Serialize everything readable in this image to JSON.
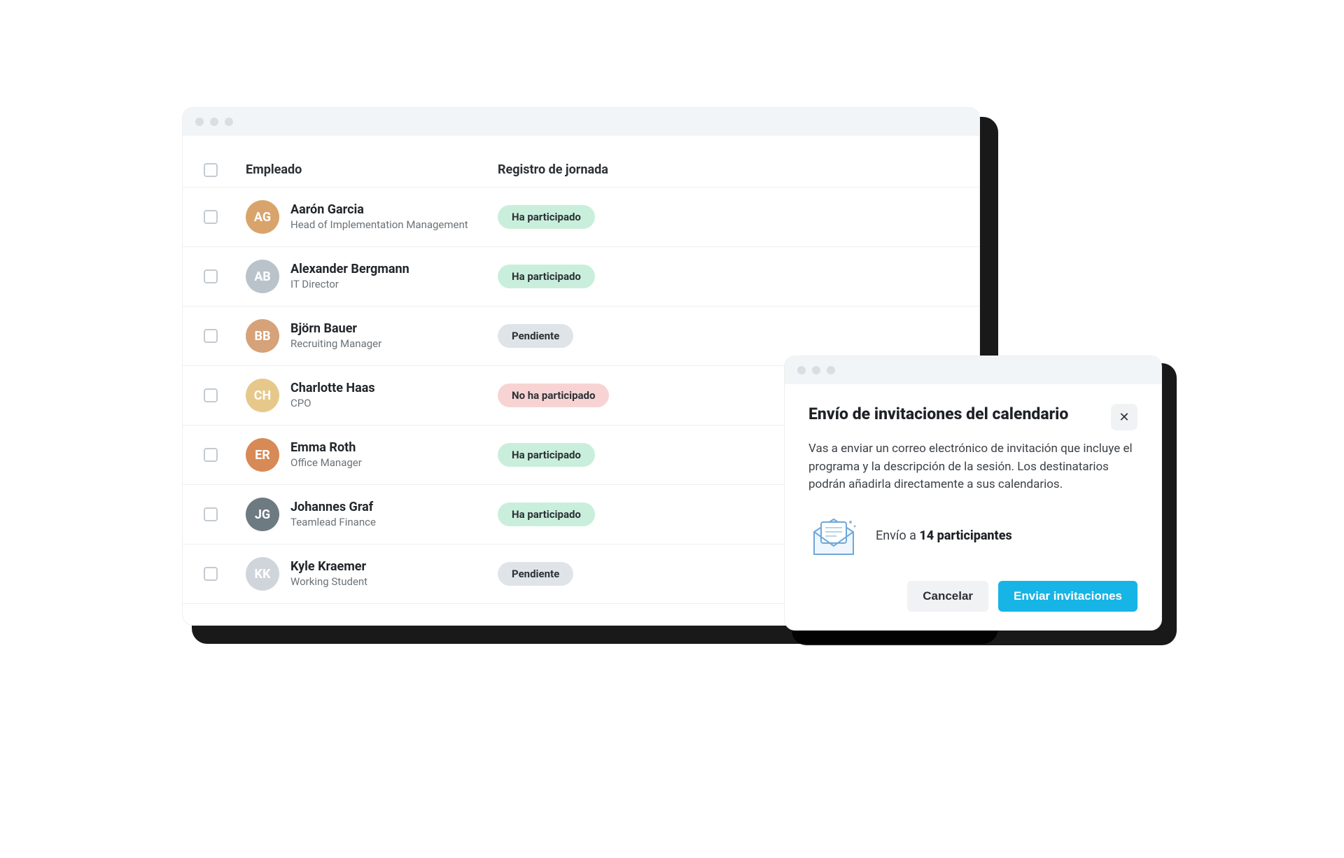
{
  "table": {
    "headers": {
      "employee": "Empleado",
      "status": "Registro de jornada"
    },
    "status_labels": {
      "participated": "Ha participado",
      "pending": "Pendiente",
      "not_participated": "No ha participado"
    },
    "rows": [
      {
        "name": "Aarón Garcia",
        "role": "Head of Implementation Management",
        "status": "participated",
        "avatar_bg": "#d9a46b",
        "initials": "AG"
      },
      {
        "name": "Alexander Bergmann",
        "role": "IT Director",
        "status": "participated",
        "avatar_bg": "#b9c3c9",
        "initials": "AB"
      },
      {
        "name": "Björn Bauer",
        "role": "Recruiting Manager",
        "status": "pending",
        "avatar_bg": "#d6a27a",
        "initials": "BB"
      },
      {
        "name": "Charlotte Haas",
        "role": "CPO",
        "status": "not_participated",
        "avatar_bg": "#e6c98a",
        "initials": "CH"
      },
      {
        "name": "Emma Roth",
        "role": "Office Manager",
        "status": "participated",
        "avatar_bg": "#d78a56",
        "initials": "ER"
      },
      {
        "name": "Johannes Graf",
        "role": "Teamlead Finance",
        "status": "participated",
        "avatar_bg": "#6e7a82",
        "initials": "JG"
      },
      {
        "name": "Kyle Kraemer",
        "role": "Working Student",
        "status": "pending",
        "avatar_bg": "#cfd5da",
        "initials": "KK"
      }
    ]
  },
  "modal": {
    "title": "Envío de invitaciones del calendario",
    "description": "Vas a enviar un correo electrónico de invitación que incluye el programa y la descripción de la sesión. Los destinatarios podrán añadirla directamente a sus calendarios.",
    "send_prefix": "Envío a ",
    "send_bold": "14 participantes",
    "cancel": "Cancelar",
    "confirm": "Enviar invitaciones",
    "close_glyph": "✕"
  }
}
